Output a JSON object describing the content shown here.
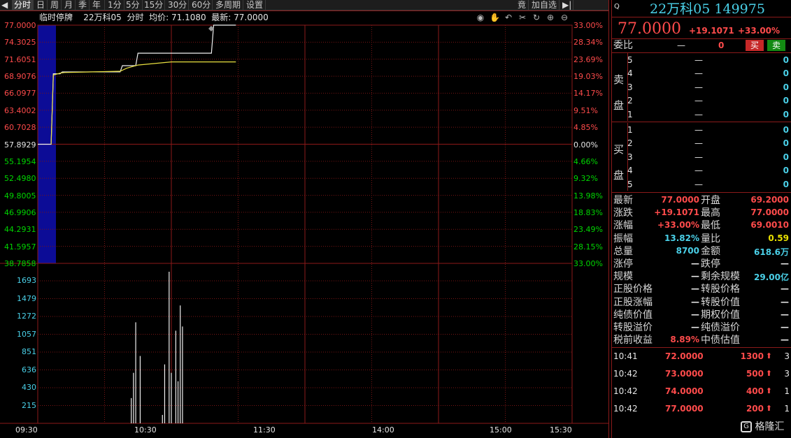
{
  "toolbar": {
    "periods": [
      "分时",
      "日",
      "周",
      "月",
      "季",
      "年",
      "1分",
      "5分",
      "15分",
      "30分",
      "60分",
      "多周期"
    ],
    "settings": "设置",
    "auction": "竟",
    "add_watchlist": "加自选"
  },
  "info": {
    "status": "临时停牌",
    "name": "22万科05",
    "period": "分时",
    "avg_label": "均价: ",
    "avg_value": "71.1080",
    "latest_label": "最新: ",
    "latest_value": "77.0000"
  },
  "quote": {
    "name": "22万科05",
    "code": "149975",
    "price": "77.0000",
    "change": "+19.1071",
    "change_pct": "+33.00%",
    "ratio_label": "委比",
    "ratio_value": "—",
    "ratio_diff": "0",
    "buy_label": "买",
    "sell_label": "卖"
  },
  "orderbook": {
    "ask_label": [
      "卖",
      "盘"
    ],
    "bid_label": [
      "买",
      "盘"
    ],
    "asks": [
      {
        "level": "5",
        "price": "—",
        "vol": "0"
      },
      {
        "level": "4",
        "price": "—",
        "vol": "0"
      },
      {
        "level": "3",
        "price": "—",
        "vol": "0"
      },
      {
        "level": "2",
        "price": "—",
        "vol": "0"
      },
      {
        "level": "1",
        "price": "—",
        "vol": "0"
      }
    ],
    "bids": [
      {
        "level": "1",
        "price": "—",
        "vol": "0"
      },
      {
        "level": "2",
        "price": "—",
        "vol": "0"
      },
      {
        "level": "3",
        "price": "—",
        "vol": "0"
      },
      {
        "level": "4",
        "price": "—",
        "vol": "0"
      },
      {
        "level": "5",
        "price": "—",
        "vol": "0"
      }
    ]
  },
  "stats": [
    {
      "l1": "最新",
      "v1": "77.0000",
      "c1": "red",
      "l2": "开盘",
      "v2": "69.2000",
      "c2": "red"
    },
    {
      "l1": "涨跌",
      "v1": "+19.1071",
      "c1": "red",
      "l2": "最高",
      "v2": "77.0000",
      "c2": "red"
    },
    {
      "l1": "涨幅",
      "v1": "+33.00%",
      "c1": "red",
      "l2": "最低",
      "v2": "69.0010",
      "c2": "red"
    },
    {
      "l1": "振幅",
      "v1": "13.82%",
      "c1": "cyan",
      "l2": "量比",
      "v2": "0.59",
      "c2": "yellow"
    },
    {
      "l1": "总量",
      "v1": "8700",
      "c1": "cyan",
      "l2": "金额",
      "v2": "618.6万",
      "c2": "cyan"
    },
    {
      "l1": "涨停",
      "v1": "—",
      "c1": "white",
      "l2": "跌停",
      "v2": "—",
      "c2": "white"
    },
    {
      "l1": "规模",
      "v1": "—",
      "c1": "white",
      "l2": "剩余规模",
      "v2": "29.00亿",
      "c2": "cyan"
    },
    {
      "l1": "正股价格",
      "v1": "—",
      "c1": "white",
      "l2": "转股价格",
      "v2": "—",
      "c2": "white"
    },
    {
      "l1": "正股涨幅",
      "v1": "—",
      "c1": "white",
      "l2": "转股价值",
      "v2": "—",
      "c2": "white"
    },
    {
      "l1": "纯债价值",
      "v1": "—",
      "c1": "white",
      "l2": "期权价值",
      "v2": "—",
      "c2": "white"
    },
    {
      "l1": "转股溢价",
      "v1": "—",
      "c1": "white",
      "l2": "纯债溢价",
      "v2": "—",
      "c2": "white"
    },
    {
      "l1": "税前收益",
      "v1": "8.89%",
      "c1": "red",
      "l2": "中债估值",
      "v2": "—",
      "c2": "white"
    }
  ],
  "trades": [
    {
      "time": "10:41",
      "price": "72.0000",
      "vol": "1300",
      "count": "3"
    },
    {
      "time": "10:42",
      "price": "73.0000",
      "vol": "500",
      "count": "3"
    },
    {
      "time": "10:42",
      "price": "74.0000",
      "vol": "400",
      "count": "1"
    },
    {
      "time": "10:42",
      "price": "77.0000",
      "vol": "200",
      "count": "1"
    }
  ],
  "watermark": "格隆汇",
  "chart_data": {
    "type": "line",
    "title": "",
    "price_ticks": [
      "77.0000",
      "74.3025",
      "71.6051",
      "68.9076",
      "66.0977",
      "63.4002",
      "60.7028",
      "57.8929",
      "55.1954",
      "52.4980",
      "49.8005",
      "46.9906",
      "44.2931",
      "41.5957",
      "38.7858"
    ],
    "pct_ticks": [
      "33.00%",
      "28.34%",
      "23.69%",
      "19.03%",
      "14.17%",
      "9.51%",
      "4.85%",
      "0.00%",
      "4.66%",
      "9.32%",
      "13.98%",
      "18.83%",
      "23.49%",
      "28.15%",
      "33.00%"
    ],
    "volume_ticks": [
      "1693",
      "1479",
      "1272",
      "1057",
      "851",
      "636",
      "430",
      "215"
    ],
    "time_ticks": [
      "09:30",
      "10:30",
      "11:30",
      "14:00",
      "15:00",
      "15:30"
    ],
    "prev_close": 57.8929,
    "ylim": [
      38.7858,
      77.0
    ],
    "price": {
      "x": [
        0,
        1,
        2,
        3,
        6,
        7,
        10,
        11,
        37,
        38,
        44,
        45,
        78,
        79,
        89
      ],
      "y": [
        57.8929,
        57.8929,
        57.8929,
        57.8929,
        57.8929,
        69.2,
        69.2,
        69.5,
        69.5,
        70.5,
        70.5,
        72.5,
        72.5,
        77.0,
        77.0
      ]
    },
    "avg_price": {
      "x": [
        6,
        7,
        10,
        12,
        37,
        40,
        45,
        60,
        89
      ],
      "y": [
        57.8929,
        69.0,
        69.3,
        69.4,
        69.6,
        70.1,
        70.6,
        71.1,
        71.1
      ]
    },
    "volume": {
      "x": [
        42,
        43,
        44,
        46,
        56,
        57,
        59,
        60,
        62,
        63,
        64,
        65
      ],
      "y": [
        300,
        600,
        1200,
        800,
        100,
        700,
        1800,
        600,
        1100,
        500,
        1400,
        1150
      ]
    },
    "volume_max": 1900
  }
}
